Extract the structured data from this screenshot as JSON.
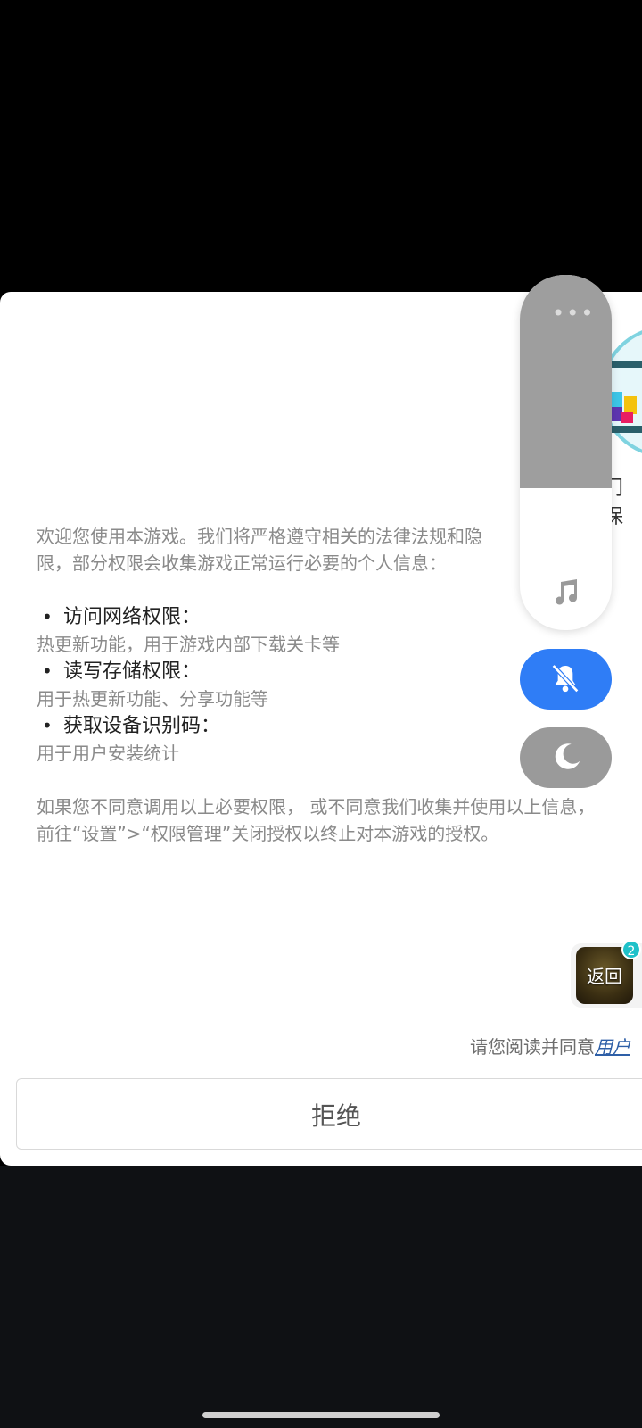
{
  "dialog": {
    "title_partial": "门保",
    "intro_line1": "欢迎您使用本游戏。我们将严格遵守相关的法律法规和隐",
    "intro_line1_tail": "保护",
    "intro_line2": "限，部分权限会收集游戏正常运行必要的个人信息：",
    "permissions": [
      {
        "title": "访问网络权限：",
        "desc": "热更新功能，用于游戏内部下载关卡等"
      },
      {
        "title": "读写存储权限：",
        "desc": "用于热更新功能、分享功能等"
      },
      {
        "title": "获取设备识别码：",
        "desc": "用于用户安装统计"
      }
    ],
    "footer_line1": "如果您不同意调用以上必要权限， 或不同意我们收集并使用以上信息，",
    "footer_line2": "前往“设置”>“权限管理”关闭授权以终止对本游戏的授权。",
    "agree_prefix": "请您阅读并同意",
    "agree_link": "用户",
    "reject_label": "拒绝"
  },
  "overlay": {
    "menu_dots": "•••",
    "back_label": "返回",
    "back_badge": "2",
    "icons": [
      "more-icon",
      "music-note-icon",
      "mute-bell-icon",
      "moon-icon"
    ],
    "colors": {
      "mute_active": "#2f7df6",
      "night": "#9a9a9a",
      "badge": "#1fc1c9"
    }
  }
}
